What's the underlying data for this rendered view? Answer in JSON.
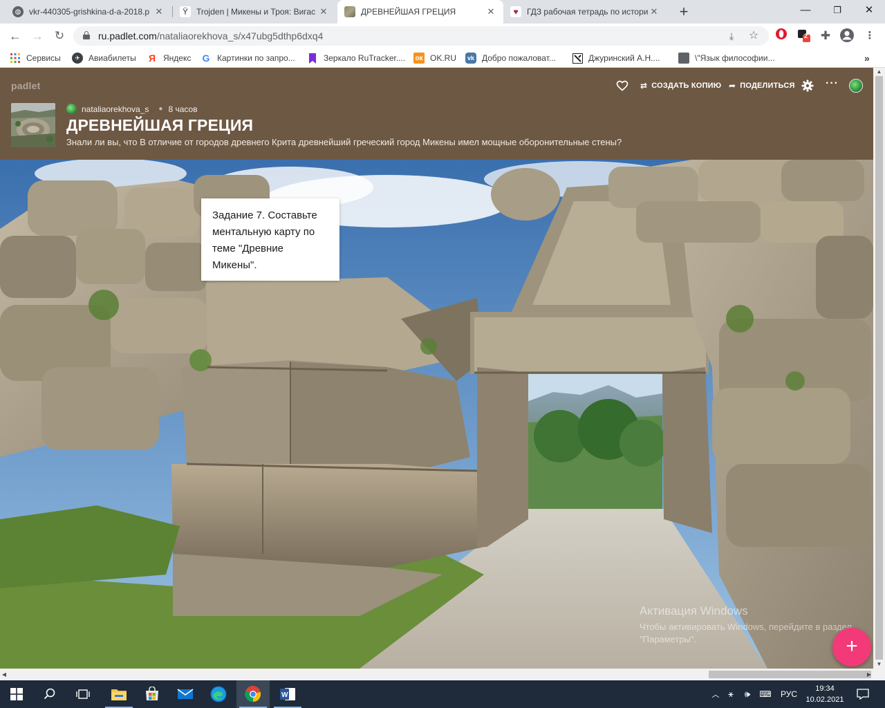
{
  "browser": {
    "tabs": [
      {
        "title": "vkr-440305-grishkina-d-a-2018.p",
        "favicon": "globe-icon",
        "color": "#5f6368"
      },
      {
        "title": "Trojden | Микены и Троя: Вигас",
        "favicon": "tree-icon",
        "color": "#5f6368"
      },
      {
        "title": "ДРЕВНЕЙШАЯ ГРЕЦИЯ",
        "favicon": "padlet-thumb-icon",
        "color": "#5f6368"
      },
      {
        "title": "ГДЗ рабочая тетрадь по истори",
        "favicon": "heart-icon",
        "color": "#5f6368"
      }
    ],
    "new_tab": "+",
    "url_host": "ru.padlet.com",
    "url_path": "/nataliaorekhova_s/x47ubg5dthp6dxq4",
    "extension_badge": "2",
    "bookmarks": [
      {
        "label": "Сервисы",
        "icon": "apps-icon"
      },
      {
        "label": "Авиабилеты",
        "icon": "plane-icon"
      },
      {
        "label": "Яндекс",
        "icon": "yandex-icon"
      },
      {
        "label": "Картинки по запро...",
        "icon": "google-icon"
      },
      {
        "label": "Зеркало RuTracker....",
        "icon": "bookmark-icon"
      },
      {
        "label": "OK.RU",
        "icon": "ok-icon"
      },
      {
        "label": "Добро пожаловат...",
        "icon": "vk-icon"
      },
      {
        "label": "Джуринский А.Н....",
        "icon": "bookmark-icon"
      },
      {
        "label": "\\\"Язык философии...",
        "icon": "doc-icon"
      }
    ]
  },
  "padlet": {
    "brand": "padlet",
    "copy_label": "СОЗДАТЬ КОПИЮ",
    "share_label": "ПОДЕЛИТЬСЯ",
    "author": "nataliaorekhova_s",
    "time_ago": "8 часов",
    "title": "ДРЕВНЕЙШАЯ ГРЕЦИЯ",
    "description": "Знали ли вы, что В отличие от городов древнего Крита древнейший греческий город Микены имел мощные оборонительные стены?",
    "header_color": "#6d5844",
    "accent_color": "#f23a78",
    "post": {
      "text": "Задание 7. Составьте ментальную карту по теме \"Древние Микены\"."
    },
    "fab_label": "+"
  },
  "watermark": {
    "title": "Активация Windows",
    "text": "Чтобы активировать Windows, перейдите в раздел \"Параметры\"."
  },
  "taskbar": {
    "language": "РУС",
    "time": "19:34",
    "date": "10.02.2021"
  }
}
